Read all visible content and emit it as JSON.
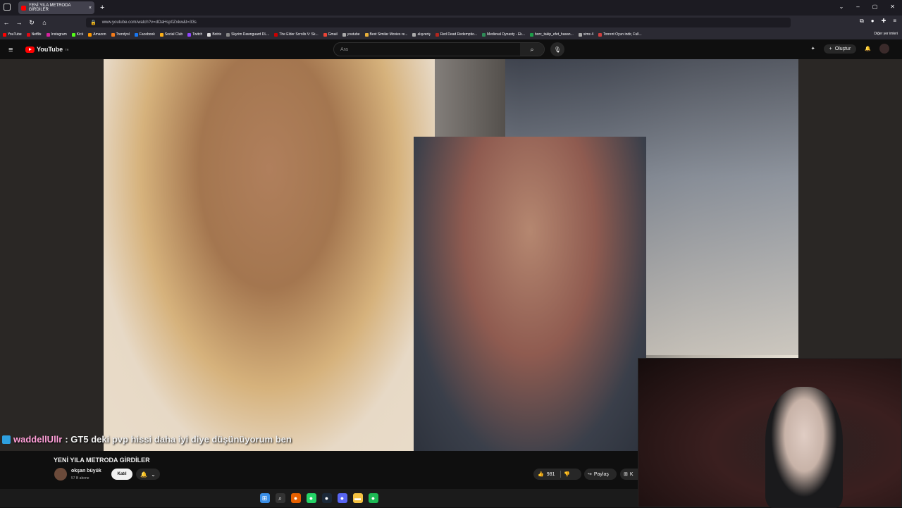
{
  "browser": {
    "tab_title": "YENİ YILA METRODA GİRDİLER",
    "tab_close": "×",
    "new_tab": "+",
    "url": "www.youtube.com/watch?v=dOaHsp0Zxkw&t=33s",
    "bookmarks": [
      {
        "label": "YouTube",
        "color": "#ff0000"
      },
      {
        "label": "Netflix",
        "color": "#e50914"
      },
      {
        "label": "Instagram",
        "color": "#d6249f"
      },
      {
        "label": "Kick",
        "color": "#53fc18"
      },
      {
        "label": "Amazon",
        "color": "#ff9900"
      },
      {
        "label": "Trendyol",
        "color": "#f27a1a"
      },
      {
        "label": "Facebook",
        "color": "#1877f2"
      },
      {
        "label": "Social Club",
        "color": "#fcaf17"
      },
      {
        "label": "Twitch",
        "color": "#9146ff"
      },
      {
        "label": "Botrix",
        "color": "#dddddd"
      },
      {
        "label": "Skyrim Dawnguard DL...",
        "color": "#888888"
      },
      {
        "label": "The Elder Scrolls V: Sk...",
        "color": "#cc0000"
      },
      {
        "label": "Gmail",
        "color": "#ea4335"
      },
      {
        "label": "youtube",
        "color": "#aaaaaa"
      },
      {
        "label": "Best Similar Movies re...",
        "color": "#e9b03a"
      },
      {
        "label": "alışveriş",
        "color": "#aaaaaa"
      },
      {
        "label": "Red Dead Redemptio...",
        "color": "#b3261e"
      },
      {
        "label": "Medieval Dynasty - Ek...",
        "color": "#2e8b57"
      },
      {
        "label": "borc_takip_efet_hasan...",
        "color": "#1e9e4a"
      },
      {
        "label": "sims 4",
        "color": "#aaaaaa"
      },
      {
        "label": "Torrent Oyun indir, Full...",
        "color": "#d04040"
      }
    ],
    "other_bookmarks": "Diğer yer imleri"
  },
  "youtube": {
    "logo_text": "YouTube",
    "logo_region": "TR",
    "search_placeholder": "Ara",
    "create_label": "Oluştur"
  },
  "chat_overlay": {
    "username": "waddellUllr",
    "message": " : GT5 deki pvp hissi daha iyi diye düşünüyorum ben"
  },
  "video": {
    "title": "YENİ YILA METRODA GİRDİLER",
    "channel_name": "okşan büyük",
    "subscribers": "57 B abone",
    "join_label": "Katıl",
    "likes": "981",
    "share_label": "Paylaş",
    "save_label_partial": "K"
  },
  "icons": {
    "hamburger": "≡",
    "search": "⌕",
    "mic": "🎙",
    "bell": "🔔",
    "chevron": "⌄",
    "like": "👍",
    "dislike": "👎",
    "share": "↪",
    "save": "⊞",
    "plus": "+"
  },
  "taskbar": [
    {
      "name": "windows-start-icon",
      "color": "#3a8ee6",
      "glyph": "⊞"
    },
    {
      "name": "search-icon",
      "color": "#333333",
      "glyph": "⌕"
    },
    {
      "name": "firefox-icon",
      "color": "#e66000",
      "glyph": "●"
    },
    {
      "name": "whatsapp-icon",
      "color": "#25d366",
      "glyph": "●"
    },
    {
      "name": "steam-icon",
      "color": "#1b2838",
      "glyph": "●"
    },
    {
      "name": "discord-icon",
      "color": "#5865f2",
      "glyph": "●"
    },
    {
      "name": "folder-icon",
      "color": "#f5c242",
      "glyph": "▬"
    },
    {
      "name": "spotify-icon",
      "color": "#1db954",
      "glyph": "●"
    }
  ]
}
